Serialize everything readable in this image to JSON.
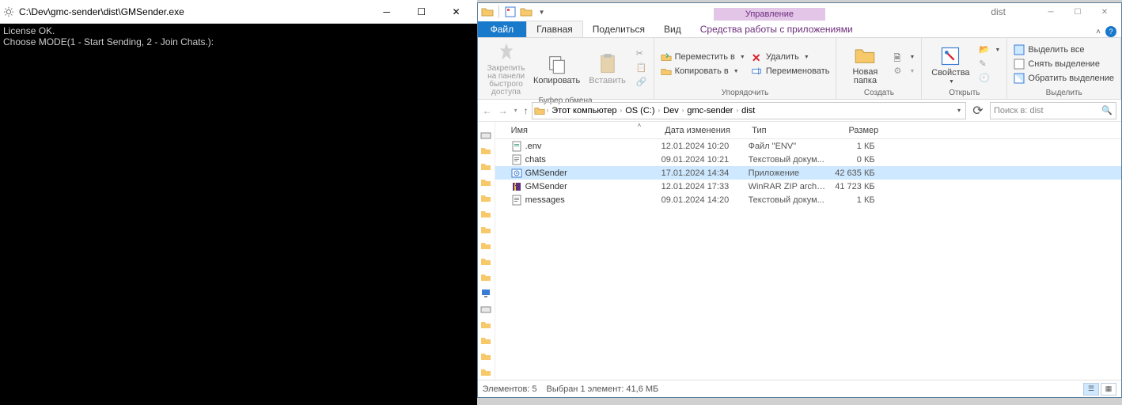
{
  "console": {
    "title": "C:\\Dev\\gmc-sender\\dist\\GMSender.exe",
    "lines": [
      "License OK.",
      "Choose MODE(1 - Start Sending, 2 - Join Chats.):"
    ]
  },
  "explorer": {
    "context_tab": "Управление",
    "window_title": "dist",
    "tabs": {
      "file": "Файл",
      "home": "Главная",
      "share": "Поделиться",
      "view": "Вид",
      "apptools": "Средства работы с приложениями"
    },
    "ribbon": {
      "pin": "Закрепить на панели быстрого доступа",
      "copy": "Копировать",
      "paste": "Вставить",
      "clipboard_group": "Буфер обмена",
      "move_to": "Переместить в",
      "copy_to": "Копировать в",
      "delete": "Удалить",
      "rename": "Переименовать",
      "organize_group": "Упорядочить",
      "new_folder": "Новая папка",
      "new_group": "Создать",
      "properties": "Свойства",
      "open_group": "Открыть",
      "select_all": "Выделить все",
      "select_none": "Снять выделение",
      "invert_selection": "Обратить выделение",
      "select_group": "Выделить"
    },
    "breadcrumb": [
      "Этот компьютер",
      "OS (C:)",
      "Dev",
      "gmc-sender",
      "dist"
    ],
    "search_placeholder": "Поиск в: dist",
    "columns": {
      "name": "Имя",
      "date": "Дата изменения",
      "type": "Тип",
      "size": "Размер"
    },
    "files": [
      {
        "icon": "env",
        "name": ".env",
        "date": "12.01.2024 10:20",
        "type": "Файл \"ENV\"",
        "size": "1 КБ",
        "selected": false
      },
      {
        "icon": "txt",
        "name": "chats",
        "date": "09.01.2024 10:21",
        "type": "Текстовый докум...",
        "size": "0 КБ",
        "selected": false
      },
      {
        "icon": "exe",
        "name": "GMSender",
        "date": "17.01.2024 14:34",
        "type": "Приложение",
        "size": "42 635 КБ",
        "selected": true
      },
      {
        "icon": "zip",
        "name": "GMSender",
        "date": "12.01.2024 17:33",
        "type": "WinRAR ZIP archive",
        "size": "41 723 КБ",
        "selected": false
      },
      {
        "icon": "txt",
        "name": "messages",
        "date": "09.01.2024 14:20",
        "type": "Текстовый докум...",
        "size": "1 КБ",
        "selected": false
      }
    ],
    "status": {
      "count": "Элементов: 5",
      "selection": "Выбран 1 элемент: 41,6 МБ"
    }
  }
}
